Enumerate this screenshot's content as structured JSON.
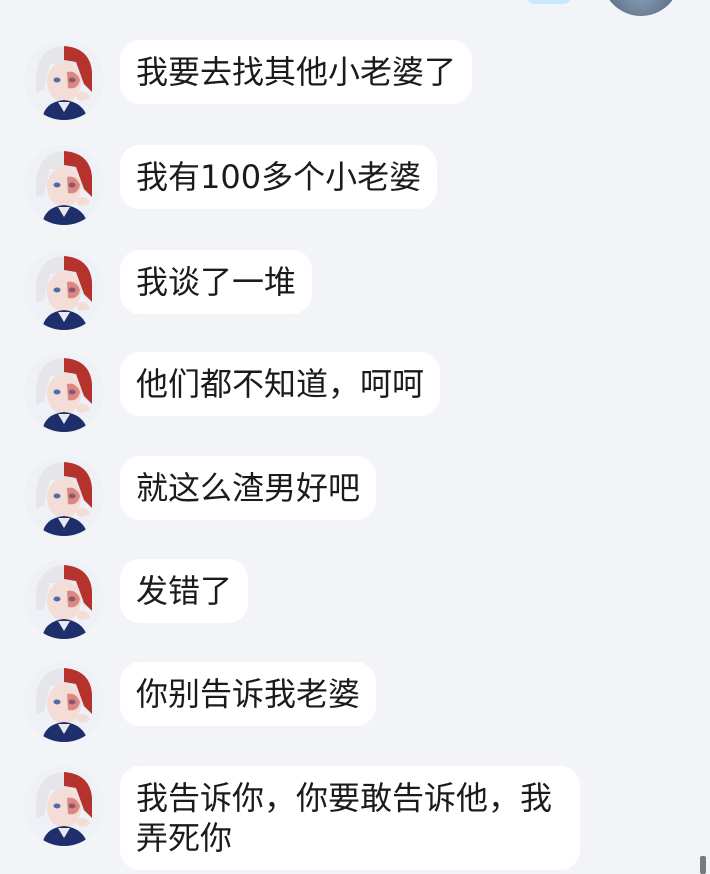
{
  "chat": {
    "messages": [
      {
        "sender": "contact",
        "text": "我要去找其他小老婆了"
      },
      {
        "sender": "contact",
        "text": "我有100多个小老婆"
      },
      {
        "sender": "contact",
        "text": "我谈了一堆"
      },
      {
        "sender": "contact",
        "text": "他们都不知道，呵呵"
      },
      {
        "sender": "contact",
        "text": "就这么渣男好吧"
      },
      {
        "sender": "contact",
        "text": "发错了"
      },
      {
        "sender": "contact",
        "text": "你别告诉我老婆"
      },
      {
        "sender": "contact",
        "text": "我告诉你，你要敢告诉他，我弄死你"
      }
    ]
  },
  "colors": {
    "background": "#f3f4f8",
    "bubble": "#ffffff",
    "text": "#1b1b1b"
  },
  "icons": {
    "contact_avatar": "anime-character-avatar"
  }
}
